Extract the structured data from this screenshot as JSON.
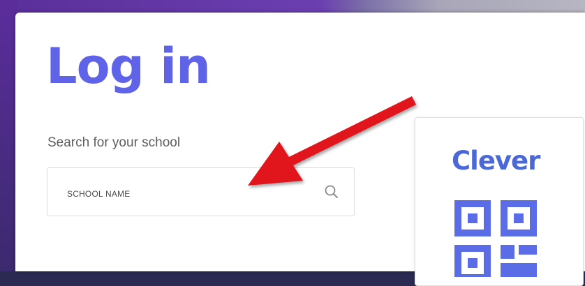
{
  "page": {
    "title": "Log in"
  },
  "search": {
    "label": "Search for your school",
    "placeholder": "SCHOOL NAME",
    "icon": "search-icon"
  },
  "clever": {
    "logo_text": "Clever",
    "icon": "qr-code-icon"
  },
  "annotation": {
    "icon": "red-arrow-icon"
  },
  "colors": {
    "brand": "#5f63e8",
    "clever_blue": "#4a68d8",
    "arrow": "#e0141c"
  }
}
